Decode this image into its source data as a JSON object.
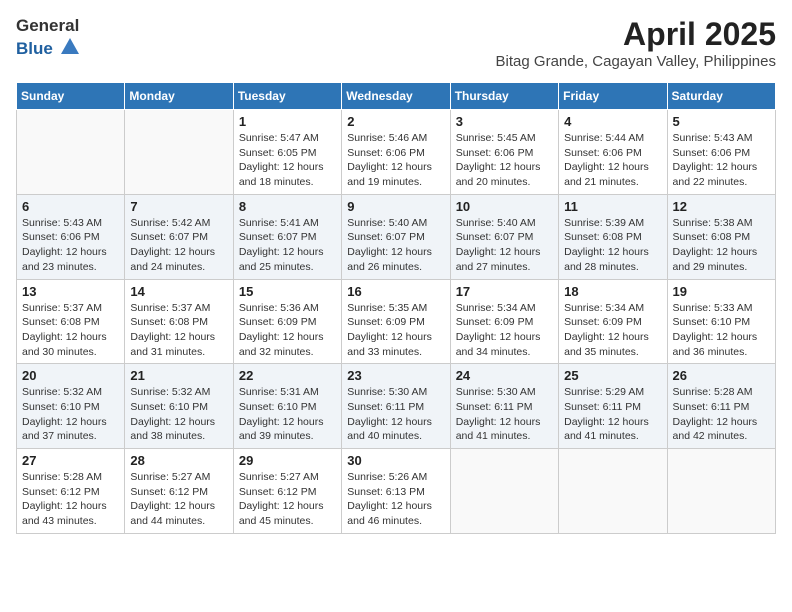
{
  "header": {
    "logo_line1": "General",
    "logo_line2": "Blue",
    "month_year": "April 2025",
    "location": "Bitag Grande, Cagayan Valley, Philippines"
  },
  "columns": [
    "Sunday",
    "Monday",
    "Tuesday",
    "Wednesday",
    "Thursday",
    "Friday",
    "Saturday"
  ],
  "weeks": [
    [
      {
        "day": "",
        "info": ""
      },
      {
        "day": "",
        "info": ""
      },
      {
        "day": "1",
        "info": "Sunrise: 5:47 AM\nSunset: 6:05 PM\nDaylight: 12 hours and 18 minutes."
      },
      {
        "day": "2",
        "info": "Sunrise: 5:46 AM\nSunset: 6:06 PM\nDaylight: 12 hours and 19 minutes."
      },
      {
        "day": "3",
        "info": "Sunrise: 5:45 AM\nSunset: 6:06 PM\nDaylight: 12 hours and 20 minutes."
      },
      {
        "day": "4",
        "info": "Sunrise: 5:44 AM\nSunset: 6:06 PM\nDaylight: 12 hours and 21 minutes."
      },
      {
        "day": "5",
        "info": "Sunrise: 5:43 AM\nSunset: 6:06 PM\nDaylight: 12 hours and 22 minutes."
      }
    ],
    [
      {
        "day": "6",
        "info": "Sunrise: 5:43 AM\nSunset: 6:06 PM\nDaylight: 12 hours and 23 minutes."
      },
      {
        "day": "7",
        "info": "Sunrise: 5:42 AM\nSunset: 6:07 PM\nDaylight: 12 hours and 24 minutes."
      },
      {
        "day": "8",
        "info": "Sunrise: 5:41 AM\nSunset: 6:07 PM\nDaylight: 12 hours and 25 minutes."
      },
      {
        "day": "9",
        "info": "Sunrise: 5:40 AM\nSunset: 6:07 PM\nDaylight: 12 hours and 26 minutes."
      },
      {
        "day": "10",
        "info": "Sunrise: 5:40 AM\nSunset: 6:07 PM\nDaylight: 12 hours and 27 minutes."
      },
      {
        "day": "11",
        "info": "Sunrise: 5:39 AM\nSunset: 6:08 PM\nDaylight: 12 hours and 28 minutes."
      },
      {
        "day": "12",
        "info": "Sunrise: 5:38 AM\nSunset: 6:08 PM\nDaylight: 12 hours and 29 minutes."
      }
    ],
    [
      {
        "day": "13",
        "info": "Sunrise: 5:37 AM\nSunset: 6:08 PM\nDaylight: 12 hours and 30 minutes."
      },
      {
        "day": "14",
        "info": "Sunrise: 5:37 AM\nSunset: 6:08 PM\nDaylight: 12 hours and 31 minutes."
      },
      {
        "day": "15",
        "info": "Sunrise: 5:36 AM\nSunset: 6:09 PM\nDaylight: 12 hours and 32 minutes."
      },
      {
        "day": "16",
        "info": "Sunrise: 5:35 AM\nSunset: 6:09 PM\nDaylight: 12 hours and 33 minutes."
      },
      {
        "day": "17",
        "info": "Sunrise: 5:34 AM\nSunset: 6:09 PM\nDaylight: 12 hours and 34 minutes."
      },
      {
        "day": "18",
        "info": "Sunrise: 5:34 AM\nSunset: 6:09 PM\nDaylight: 12 hours and 35 minutes."
      },
      {
        "day": "19",
        "info": "Sunrise: 5:33 AM\nSunset: 6:10 PM\nDaylight: 12 hours and 36 minutes."
      }
    ],
    [
      {
        "day": "20",
        "info": "Sunrise: 5:32 AM\nSunset: 6:10 PM\nDaylight: 12 hours and 37 minutes."
      },
      {
        "day": "21",
        "info": "Sunrise: 5:32 AM\nSunset: 6:10 PM\nDaylight: 12 hours and 38 minutes."
      },
      {
        "day": "22",
        "info": "Sunrise: 5:31 AM\nSunset: 6:10 PM\nDaylight: 12 hours and 39 minutes."
      },
      {
        "day": "23",
        "info": "Sunrise: 5:30 AM\nSunset: 6:11 PM\nDaylight: 12 hours and 40 minutes."
      },
      {
        "day": "24",
        "info": "Sunrise: 5:30 AM\nSunset: 6:11 PM\nDaylight: 12 hours and 41 minutes."
      },
      {
        "day": "25",
        "info": "Sunrise: 5:29 AM\nSunset: 6:11 PM\nDaylight: 12 hours and 41 minutes."
      },
      {
        "day": "26",
        "info": "Sunrise: 5:28 AM\nSunset: 6:11 PM\nDaylight: 12 hours and 42 minutes."
      }
    ],
    [
      {
        "day": "27",
        "info": "Sunrise: 5:28 AM\nSunset: 6:12 PM\nDaylight: 12 hours and 43 minutes."
      },
      {
        "day": "28",
        "info": "Sunrise: 5:27 AM\nSunset: 6:12 PM\nDaylight: 12 hours and 44 minutes."
      },
      {
        "day": "29",
        "info": "Sunrise: 5:27 AM\nSunset: 6:12 PM\nDaylight: 12 hours and 45 minutes."
      },
      {
        "day": "30",
        "info": "Sunrise: 5:26 AM\nSunset: 6:13 PM\nDaylight: 12 hours and 46 minutes."
      },
      {
        "day": "",
        "info": ""
      },
      {
        "day": "",
        "info": ""
      },
      {
        "day": "",
        "info": ""
      }
    ]
  ]
}
